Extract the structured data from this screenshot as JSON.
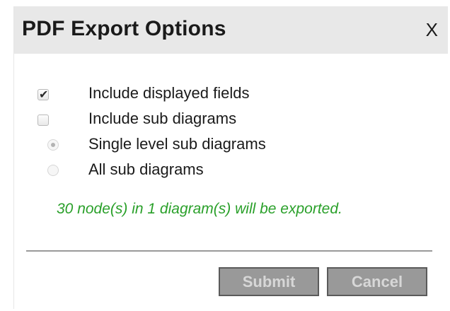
{
  "dialog": {
    "title": "PDF Export Options",
    "close_label": "X",
    "options": [
      {
        "type": "checkbox",
        "label": "Include displayed fields",
        "checked": true
      },
      {
        "type": "checkbox",
        "label": "Include sub diagrams",
        "checked": false
      },
      {
        "type": "radio",
        "label": "Single level sub diagrams",
        "checked": true,
        "disabled": true
      },
      {
        "type": "radio",
        "label": "All sub diagrams",
        "checked": false,
        "disabled": true
      }
    ],
    "status_text": "30 node(s) in 1 diagram(s) will be exported.",
    "submit_label": "Submit",
    "cancel_label": "Cancel"
  },
  "colors": {
    "titlebar_bg": "#e8e8e8",
    "status_text": "#2aa02a",
    "button_bg": "#999999"
  }
}
